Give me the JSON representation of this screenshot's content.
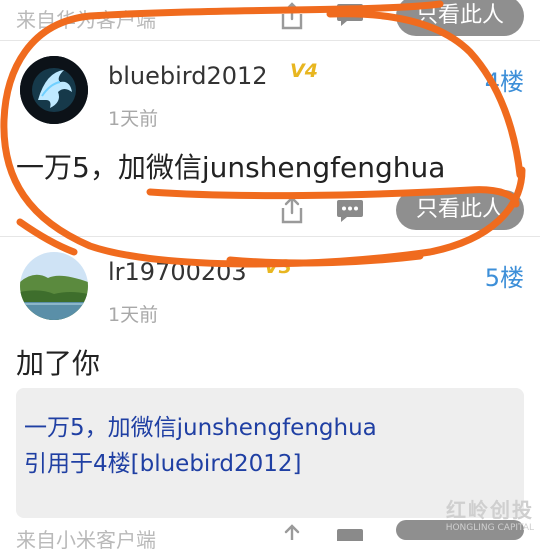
{
  "top_post": {
    "source": "来自华为客户端",
    "view_only_label": "只看此人"
  },
  "post4": {
    "username": "bluebird2012",
    "level": "V4",
    "floor": "4楼",
    "time": "1天前",
    "content": "一万5，加微信junshengfenghua",
    "view_only_label": "只看此人"
  },
  "post5": {
    "username": "lr19700203",
    "level": "V3",
    "floor": "5楼",
    "time": "1天前",
    "content": "加了你",
    "quote_text": "一万5，加微信junshengfenghua",
    "quote_ref": "引用于4楼[bluebird2012]"
  },
  "bottom": {
    "source": "来自小米客户端"
  },
  "watermark": {
    "main": "红岭创投",
    "sub": "HONGLING CAPITAL"
  },
  "colors": {
    "annotation_stroke": "#f06b1e",
    "floor_link": "#3d8fd8",
    "quote_text": "#1f3fa3",
    "pill_bg": "#8f8f8f"
  }
}
